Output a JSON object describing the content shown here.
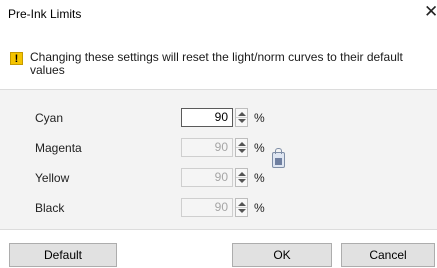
{
  "window": {
    "title": "Pre-Ink Limits",
    "close_glyph": "✕"
  },
  "warning": {
    "icon": "warning-icon",
    "icon_glyph": "!",
    "text": "Changing these settings will reset the light/norm curves to their default values"
  },
  "limits": [
    {
      "label": "Cyan",
      "value": "90",
      "unit": "%",
      "enabled": true
    },
    {
      "label": "Magenta",
      "value": "90",
      "unit": "%",
      "enabled": false
    },
    {
      "label": "Yellow",
      "value": "90",
      "unit": "%",
      "enabled": false
    },
    {
      "label": "Black",
      "value": "90",
      "unit": "%",
      "enabled": false
    }
  ],
  "link": {
    "icon": "lock-icon"
  },
  "buttons": {
    "default": "Default",
    "ok": "OK",
    "cancel": "Cancel"
  }
}
